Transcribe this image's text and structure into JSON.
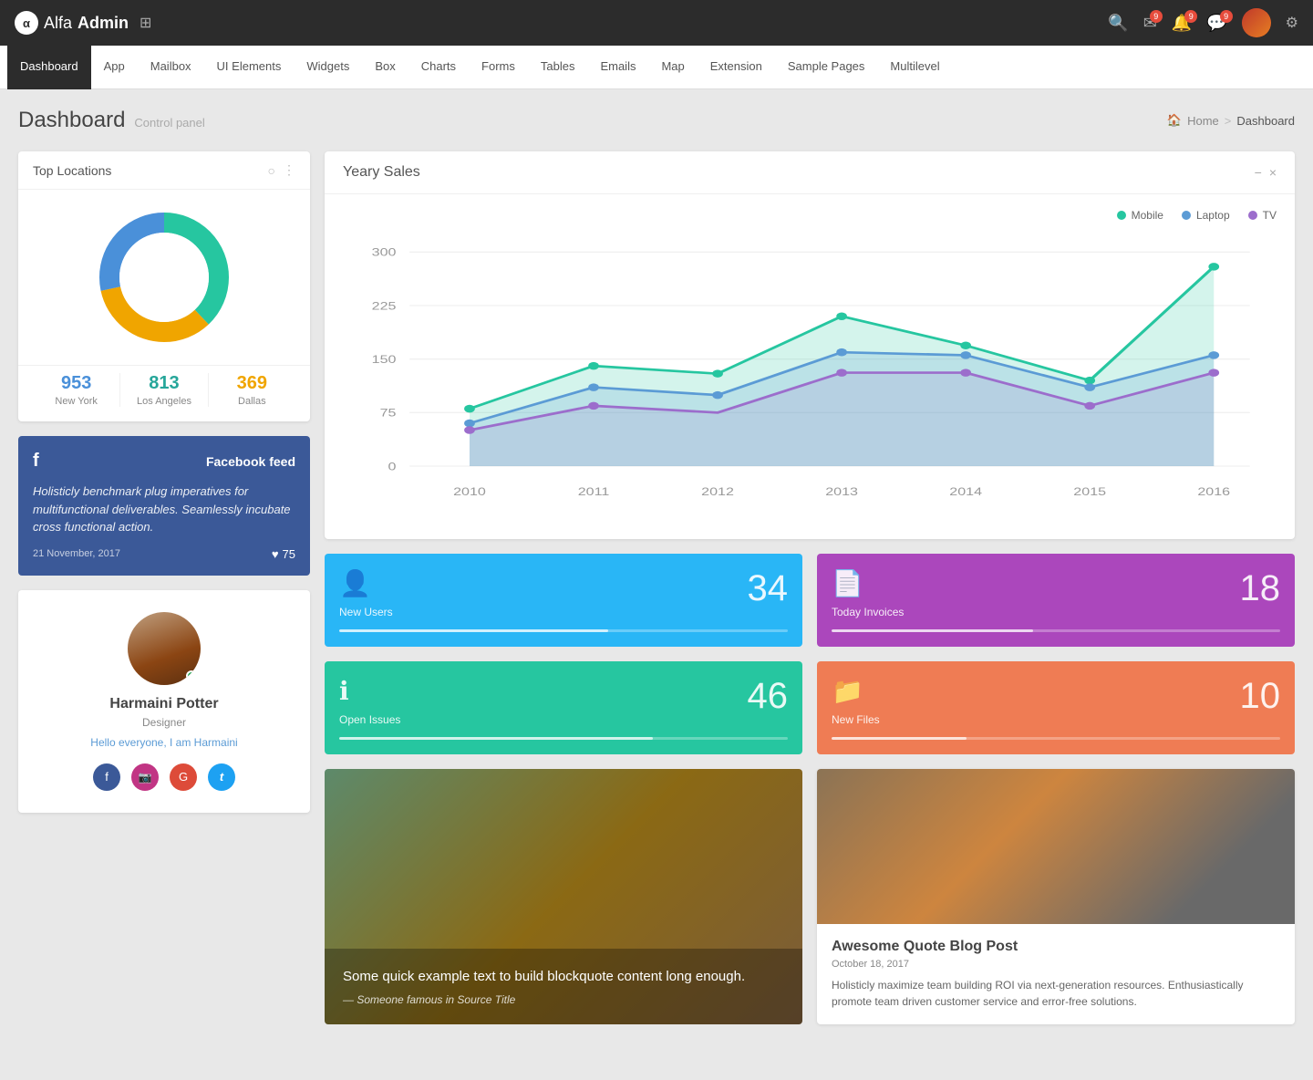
{
  "topNav": {
    "brandAlpha": "α",
    "brandAlfa": "Alfa",
    "brandAdmin": "Admin",
    "gridIcon": "⊞",
    "badge1": "9",
    "badge2": "9",
    "badge3": "9",
    "gearIcon": "⚙"
  },
  "menuBar": {
    "items": [
      {
        "label": "Dashboard",
        "active": true
      },
      {
        "label": "App",
        "active": false
      },
      {
        "label": "Mailbox",
        "active": false
      },
      {
        "label": "UI Elements",
        "active": false
      },
      {
        "label": "Widgets",
        "active": false
      },
      {
        "label": "Box",
        "active": false
      },
      {
        "label": "Charts",
        "active": false
      },
      {
        "label": "Forms",
        "active": false
      },
      {
        "label": "Tables",
        "active": false
      },
      {
        "label": "Emails",
        "active": false
      },
      {
        "label": "Map",
        "active": false
      },
      {
        "label": "Extension",
        "active": false
      },
      {
        "label": "Sample Pages",
        "active": false
      },
      {
        "label": "Multilevel",
        "active": false
      }
    ]
  },
  "pageHeader": {
    "title": "Dashboard",
    "subtitle": "Control panel",
    "breadcrumb": {
      "homeLabel": "Home",
      "separator": ">",
      "currentLabel": "Dashboard",
      "homeIcon": "🏠"
    }
  },
  "topLocations": {
    "title": "Top Locations",
    "stats": [
      {
        "number": "953",
        "label": "New York",
        "colorClass": "stat-blue"
      },
      {
        "number": "813",
        "label": "Los Angeles",
        "colorClass": "stat-green"
      },
      {
        "number": "369",
        "label": "Dallas",
        "colorClass": "stat-orange"
      }
    ],
    "donutSegments": [
      {
        "color": "#26c6a0",
        "percent": 38
      },
      {
        "color": "#f0a500",
        "percent": 34
      },
      {
        "color": "#4a90d9",
        "percent": 28
      }
    ]
  },
  "facebookFeed": {
    "icon": "f",
    "title": "Facebook feed",
    "text": "Holisticly benchmark plug imperatives for multifunctional deliverables. Seamlessly incubate cross functional action.",
    "date": "21 November, 2017",
    "likes": "75",
    "heartIcon": "♥"
  },
  "profile": {
    "name": "Harmaini Potter",
    "role": "Designer",
    "description": "Hello everyone, I am Harmaini",
    "social": {
      "facebook": "f",
      "instagram": "📷",
      "google": "G",
      "twitter": "t"
    }
  },
  "yearlySales": {
    "title": "Yeary Sales",
    "minimizeIcon": "−",
    "closeIcon": "×",
    "legend": [
      {
        "label": "Mobile",
        "colorClass": "legend-green"
      },
      {
        "label": "Laptop",
        "colorClass": "legend-blue"
      },
      {
        "label": "TV",
        "colorClass": "legend-purple"
      }
    ],
    "yAxis": [
      "300",
      "225",
      "150",
      "75",
      "0"
    ],
    "xAxis": [
      "2010",
      "2011",
      "2012",
      "2013",
      "2014",
      "2015",
      "2016"
    ],
    "chartData": {
      "mobile": [
        80,
        140,
        130,
        210,
        170,
        120,
        280
      ],
      "laptop": [
        60,
        110,
        100,
        160,
        155,
        110,
        155
      ],
      "tv": [
        50,
        85,
        75,
        130,
        130,
        85,
        130
      ]
    }
  },
  "statCards": [
    {
      "icon": "👤",
      "label": "New Users",
      "number": "34",
      "progress": 60,
      "colorClass": "stat-card-blue"
    },
    {
      "icon": "📄",
      "label": "Today Invoices",
      "number": "18",
      "progress": 45,
      "colorClass": "stat-card-purple"
    },
    {
      "icon": "ℹ",
      "label": "Open Issues",
      "number": "46",
      "progress": 70,
      "colorClass": "stat-card-green"
    },
    {
      "icon": "📁",
      "label": "New Files",
      "number": "10",
      "progress": 30,
      "colorClass": "stat-card-orange"
    }
  ],
  "quoteCard": {
    "text": "Some quick example text to build blockquote content long enough.",
    "author": "— Someone famous in Source Title"
  },
  "blogCard": {
    "title": "Awesome Quote Blog Post",
    "date": "October 18, 2017",
    "text": "Holisticly maximize team building ROI via next-generation resources. Enthusiastically promote team driven customer service and error-free solutions."
  }
}
